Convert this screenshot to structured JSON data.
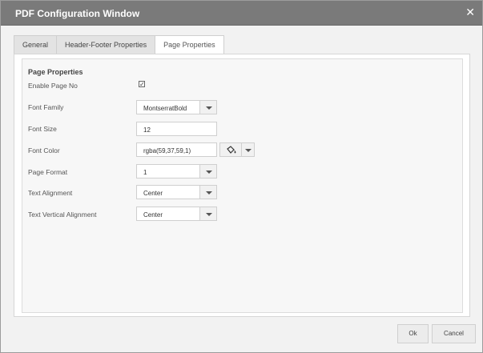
{
  "window": {
    "title": "PDF Configuration Window",
    "close_icon": "close-icon"
  },
  "tabs": [
    {
      "label": "General",
      "active": false
    },
    {
      "label": "Header-Footer Properties",
      "active": false
    },
    {
      "label": "Page Properties",
      "active": true
    }
  ],
  "page_properties": {
    "legend": "Page Properties",
    "enable_page_no": {
      "label": "Enable Page No",
      "checked": true
    },
    "font_family": {
      "label": "Font Family",
      "value": "MontserratBold"
    },
    "font_size": {
      "label": "Font Size",
      "value": "12"
    },
    "font_color": {
      "label": "Font Color",
      "value": "rgba(59,37,59,1)",
      "icon": "paint-bucket-icon"
    },
    "page_format": {
      "label": "Page Format",
      "value": "1"
    },
    "text_alignment": {
      "label": "Text Alignment",
      "value": "Center"
    },
    "text_vertical_alignment": {
      "label": "Text Vertical Alignment",
      "value": "Center"
    }
  },
  "footer": {
    "ok_label": "Ok",
    "cancel_label": "Cancel"
  }
}
